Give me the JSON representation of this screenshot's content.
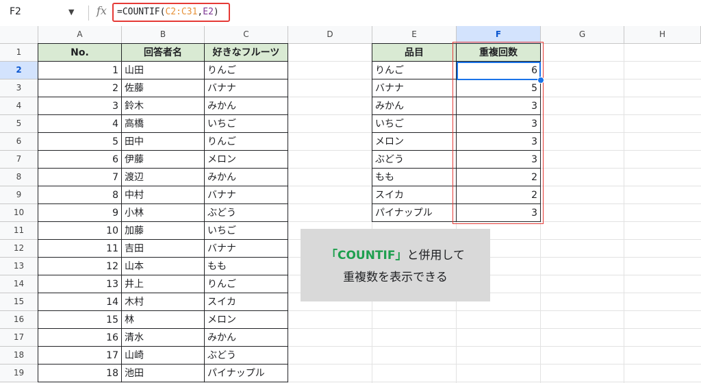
{
  "formula_bar": {
    "name_box": "F2",
    "fx_label": "fx",
    "formula_prefix": "=COUNTIF(",
    "formula_range": "C2:C31",
    "formula_comma": ",",
    "formula_ref": "E2",
    "formula_suffix": ")"
  },
  "columns": [
    "A",
    "B",
    "C",
    "D",
    "E",
    "F",
    "G",
    "H"
  ],
  "rows": [
    "1",
    "2",
    "3",
    "4",
    "5",
    "6",
    "7",
    "8",
    "9",
    "10",
    "11",
    "12",
    "13",
    "14",
    "15",
    "16",
    "17",
    "18",
    "19"
  ],
  "table_left": {
    "headers": [
      "No.",
      "回答者名",
      "好きなフルーツ"
    ],
    "rows": [
      [
        "1",
        "山田",
        "りんご"
      ],
      [
        "2",
        "佐藤",
        "バナナ"
      ],
      [
        "3",
        "鈴木",
        "みかん"
      ],
      [
        "4",
        "高橋",
        "いちご"
      ],
      [
        "5",
        "田中",
        "りんご"
      ],
      [
        "6",
        "伊藤",
        "メロン"
      ],
      [
        "7",
        "渡辺",
        "みかん"
      ],
      [
        "8",
        "中村",
        "バナナ"
      ],
      [
        "9",
        "小林",
        "ぶどう"
      ],
      [
        "10",
        "加藤",
        "いちご"
      ],
      [
        "11",
        "吉田",
        "バナナ"
      ],
      [
        "12",
        "山本",
        "もも"
      ],
      [
        "13",
        "井上",
        "りんご"
      ],
      [
        "14",
        "木村",
        "スイカ"
      ],
      [
        "15",
        "林",
        "メロン"
      ],
      [
        "16",
        "清水",
        "みかん"
      ],
      [
        "17",
        "山崎",
        "ぶどう"
      ],
      [
        "18",
        "池田",
        "パイナップル"
      ]
    ]
  },
  "table_right": {
    "headers": [
      "品目",
      "重複回数"
    ],
    "rows": [
      [
        "りんご",
        "6"
      ],
      [
        "バナナ",
        "5"
      ],
      [
        "みかん",
        "3"
      ],
      [
        "いちご",
        "3"
      ],
      [
        "メロン",
        "3"
      ],
      [
        "ぶどう",
        "3"
      ],
      [
        "もも",
        "2"
      ],
      [
        "スイカ",
        "2"
      ],
      [
        "パイナップル",
        "3"
      ]
    ]
  },
  "note": {
    "open_bracket": "「",
    "keyword": "COUNTIF",
    "close_rest": "」と併用して",
    "line2": "重複数を表示できる"
  },
  "colors": {
    "header_fill": "#d9ead3",
    "selection": "#1a73e8",
    "highlight_box": "#e53935",
    "note_bg": "#d9d9d9",
    "keyword": "#1e9f4e"
  }
}
